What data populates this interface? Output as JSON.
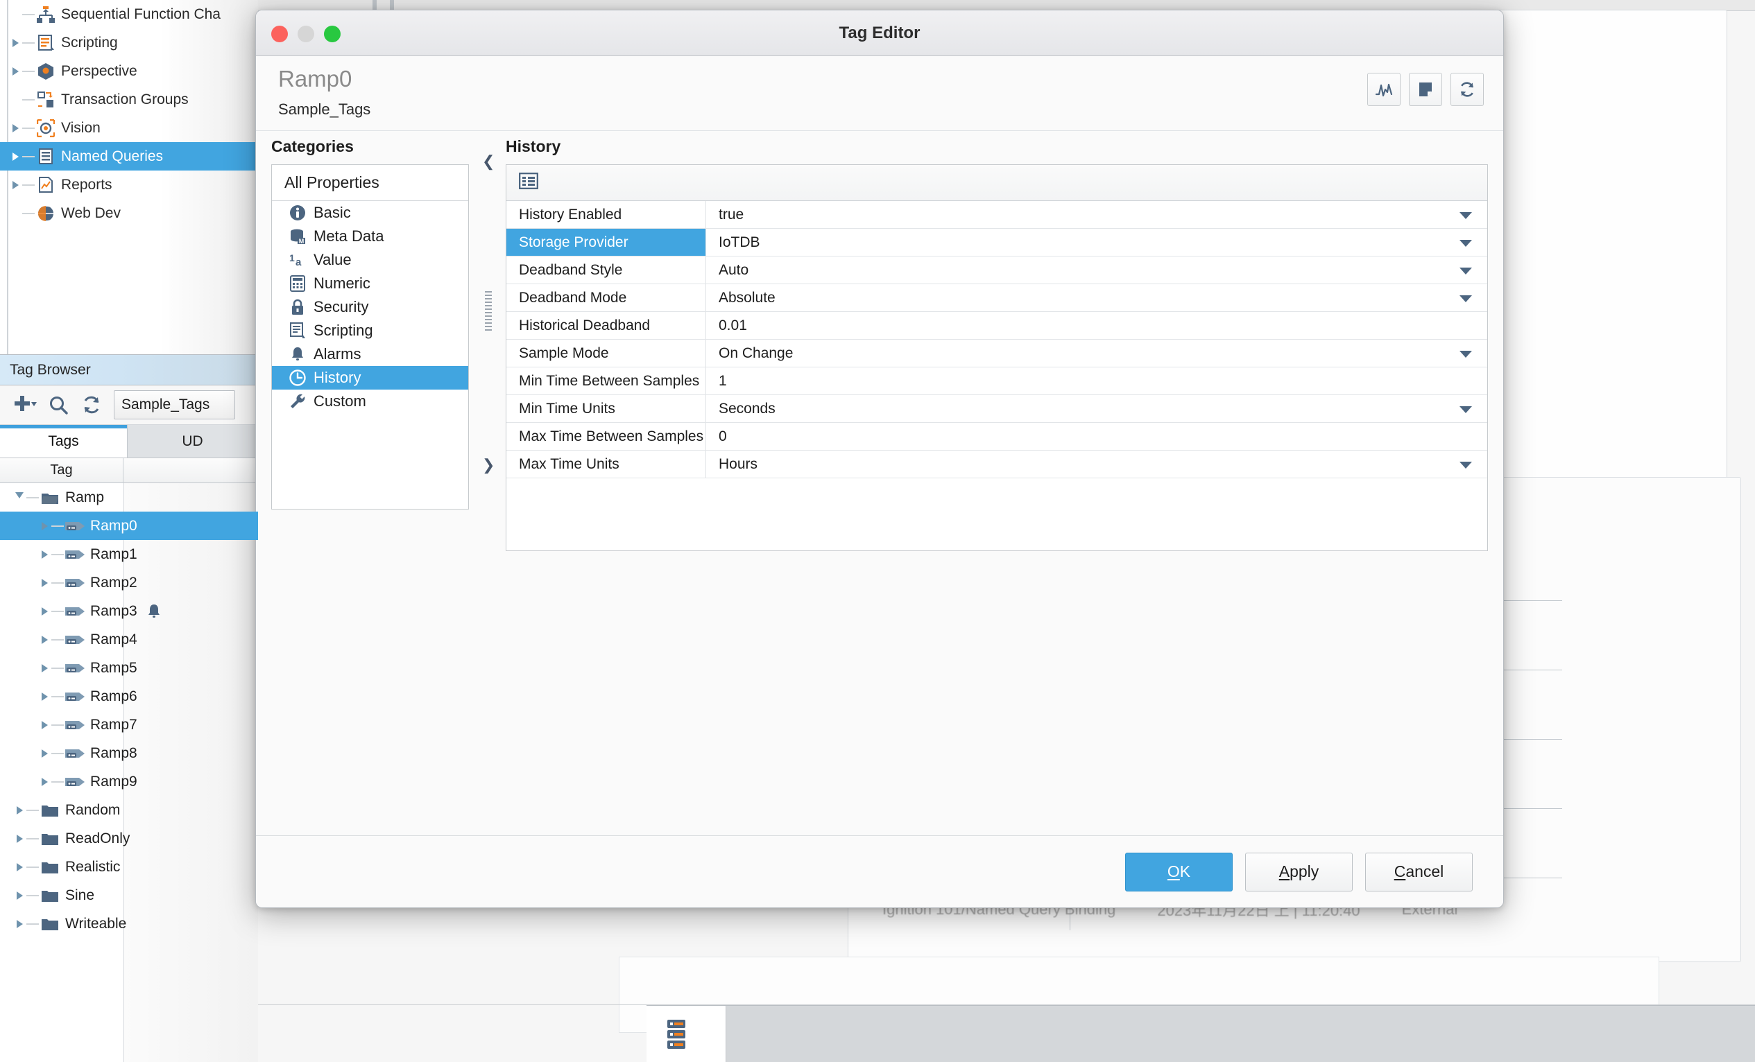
{
  "project_tree": {
    "items": [
      {
        "label": "Sequential Function Cha",
        "icon": "sfc-icon",
        "expandable": false,
        "selected": false
      },
      {
        "label": "Scripting",
        "icon": "scripting-icon",
        "expandable": true,
        "selected": false
      },
      {
        "label": "Perspective",
        "icon": "perspective-icon",
        "expandable": true,
        "selected": false
      },
      {
        "label": "Transaction Groups",
        "icon": "transaction-groups-icon",
        "expandable": false,
        "selected": false
      },
      {
        "label": "Vision",
        "icon": "vision-icon",
        "expandable": true,
        "selected": false
      },
      {
        "label": "Named Queries",
        "icon": "named-queries-icon",
        "expandable": true,
        "selected": true
      },
      {
        "label": "Reports",
        "icon": "reports-icon",
        "expandable": true,
        "selected": false
      },
      {
        "label": "Web Dev",
        "icon": "web-dev-icon",
        "expandable": false,
        "selected": false
      }
    ]
  },
  "tag_browser": {
    "title": "Tag Browser",
    "toolbar": {
      "add_icon": "plus-icon",
      "search_icon": "search-icon",
      "refresh_icon": "refresh-icon",
      "provider": "Sample_Tags"
    },
    "tabs": [
      {
        "label": "Tags",
        "active": true
      },
      {
        "label": "UD",
        "active": false
      }
    ],
    "column_header": "Tag",
    "rows": [
      {
        "label": "Ramp",
        "indent": 0,
        "icon": "folder-open-icon",
        "expanded": true,
        "selected": false,
        "alarm": false
      },
      {
        "label": "Ramp0",
        "indent": 1,
        "icon": "tag-icon",
        "expanded": false,
        "selected": true,
        "alarm": false
      },
      {
        "label": "Ramp1",
        "indent": 1,
        "icon": "tag-icon",
        "expanded": false,
        "selected": false,
        "alarm": false
      },
      {
        "label": "Ramp2",
        "indent": 1,
        "icon": "tag-icon",
        "expanded": false,
        "selected": false,
        "alarm": false
      },
      {
        "label": "Ramp3",
        "indent": 1,
        "icon": "tag-icon",
        "expanded": false,
        "selected": false,
        "alarm": true
      },
      {
        "label": "Ramp4",
        "indent": 1,
        "icon": "tag-icon",
        "expanded": false,
        "selected": false,
        "alarm": false
      },
      {
        "label": "Ramp5",
        "indent": 1,
        "icon": "tag-icon",
        "expanded": false,
        "selected": false,
        "alarm": false
      },
      {
        "label": "Ramp6",
        "indent": 1,
        "icon": "tag-icon",
        "expanded": false,
        "selected": false,
        "alarm": false
      },
      {
        "label": "Ramp7",
        "indent": 1,
        "icon": "tag-icon",
        "expanded": false,
        "selected": false,
        "alarm": false
      },
      {
        "label": "Ramp8",
        "indent": 1,
        "icon": "tag-icon",
        "expanded": false,
        "selected": false,
        "alarm": false
      },
      {
        "label": "Ramp9",
        "indent": 1,
        "icon": "tag-icon",
        "expanded": false,
        "selected": false,
        "alarm": false
      },
      {
        "label": "Random",
        "indent": 0,
        "icon": "folder-icon",
        "expanded": false,
        "selected": false,
        "alarm": false
      },
      {
        "label": "ReadOnly",
        "indent": 0,
        "icon": "folder-icon",
        "expanded": false,
        "selected": false,
        "alarm": false
      },
      {
        "label": "Realistic",
        "indent": 0,
        "icon": "folder-icon",
        "expanded": false,
        "selected": false,
        "alarm": false
      },
      {
        "label": "Sine",
        "indent": 0,
        "icon": "folder-icon",
        "expanded": false,
        "selected": false,
        "alarm": false
      },
      {
        "label": "Writeable",
        "indent": 0,
        "icon": "folder-icon",
        "expanded": false,
        "selected": false,
        "alarm": false
      }
    ]
  },
  "dialog": {
    "window_title": "Tag Editor",
    "tag_name": "Ramp0",
    "tag_provider": "Sample_Tags",
    "header_tools": [
      {
        "name": "trend-icon",
        "title": "trend"
      },
      {
        "name": "note-icon",
        "title": "note"
      },
      {
        "name": "refresh-icon",
        "title": "refresh"
      }
    ],
    "categories": {
      "label": "Categories",
      "all_properties": "All Properties",
      "items": [
        {
          "label": "Basic",
          "icon": "info-icon",
          "selected": false
        },
        {
          "label": "Meta Data",
          "icon": "metadata-icon",
          "selected": false
        },
        {
          "label": "Value",
          "icon": "value-icon",
          "selected": false
        },
        {
          "label": "Numeric",
          "icon": "numeric-icon",
          "selected": false
        },
        {
          "label": "Security",
          "icon": "lock-icon",
          "selected": false
        },
        {
          "label": "Scripting",
          "icon": "script-icon",
          "selected": false
        },
        {
          "label": "Alarms",
          "icon": "bell-icon",
          "selected": false
        },
        {
          "label": "History",
          "icon": "clock-icon",
          "selected": true
        },
        {
          "label": "Custom",
          "icon": "wrench-icon",
          "selected": false
        }
      ]
    },
    "splitter": {
      "collapse_left_icon": "chevron-left-icon",
      "expand_right_icon": "chevron-right-icon"
    },
    "properties": {
      "label": "History",
      "toolbar_icon": "list-view-icon",
      "rows": [
        {
          "key": "History Enabled",
          "value": "true",
          "dropdown": true,
          "selected": false
        },
        {
          "key": "Storage Provider",
          "value": "IoTDB",
          "dropdown": true,
          "selected": true
        },
        {
          "key": "Deadband Style",
          "value": "Auto",
          "dropdown": true,
          "selected": false
        },
        {
          "key": "Deadband Mode",
          "value": "Absolute",
          "dropdown": true,
          "selected": false
        },
        {
          "key": "Historical Deadband",
          "value": "0.01",
          "dropdown": false,
          "selected": false
        },
        {
          "key": "Sample Mode",
          "value": "On Change",
          "dropdown": true,
          "selected": false
        },
        {
          "key": "Min Time Between Samples",
          "value": "1",
          "dropdown": false,
          "selected": false
        },
        {
          "key": "Min Time Units",
          "value": "Seconds",
          "dropdown": true,
          "selected": false
        },
        {
          "key": "Max Time Between Samples",
          "value": "0",
          "dropdown": false,
          "selected": false
        },
        {
          "key": "Max Time Units",
          "value": "Hours",
          "dropdown": true,
          "selected": false
        }
      ]
    },
    "footer": {
      "ok": "OK",
      "ok_mnemonic": "O",
      "apply": "Apply",
      "apply_mnemonic": "A",
      "cancel": "Cancel",
      "cancel_mnemonic": "C"
    }
  },
  "background": {
    "obscured_row": {
      "path": "Ignition 101/Named Query Binding",
      "timestamp": "2023年11月22日 上 | 11:20:40",
      "source": "External"
    },
    "status_icon": "database-stack-icon"
  },
  "colors": {
    "accent": "#41a5e0",
    "selection": "#41a5e0",
    "icon_slate": "#4c6580",
    "ignition_orange": "#f08020"
  }
}
